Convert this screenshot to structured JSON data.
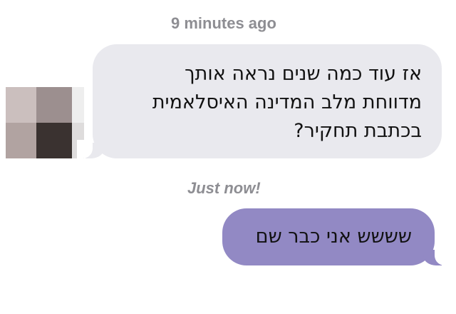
{
  "messages": [
    {
      "timestamp": "9 minutes ago",
      "direction": "incoming",
      "lines": [
        "אז עוד כמה שנים נראה אותך",
        "מדווחת מלב המדינה האיסלאמית",
        "בכתבת תחקיר?"
      ],
      "bubble_color": "#e9e9ee"
    },
    {
      "timestamp": "Just now!",
      "direction": "outgoing",
      "text": "שששש אני כבר שם",
      "bubble_color": "#9289c4"
    }
  ],
  "avatar": {
    "style": "pixelated",
    "pixels": [
      "#cbbfbe",
      "#9c8f8f",
      "#eeeeee",
      "#b1a3a1",
      "#3a3230",
      "#dedcdc"
    ]
  },
  "colors": {
    "timestamp": "#8e8e93",
    "text": "#111111"
  }
}
